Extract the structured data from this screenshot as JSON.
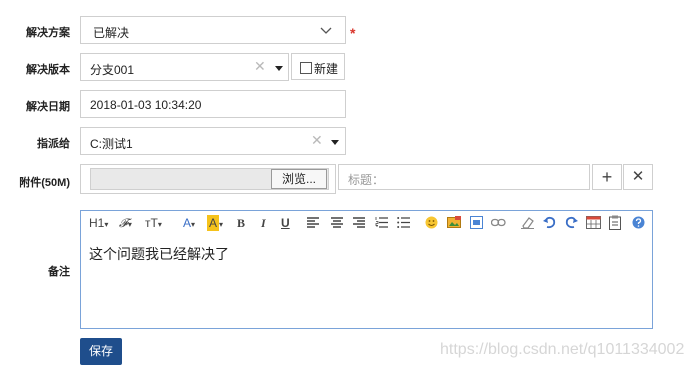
{
  "form": {
    "solution_label": "解决方案",
    "solution_value": "已解决",
    "required_mark": "*",
    "version_label": "解决版本",
    "version_value": "分支001",
    "new_label": "新建",
    "date_label": "解决日期",
    "date_value": "2018-01-03 10:34:20",
    "assign_label": "指派给",
    "assign_value": "C:测试1",
    "attach_label": "附件(50M)",
    "browse_label": "浏览...",
    "title_placeholder": "标题：",
    "add_symbol": "+",
    "remove_symbol": "✕",
    "clear_symbol": "✕",
    "remark_label": "备注",
    "remark_text": "这个问题我已经解决了",
    "save_label": "保存"
  },
  "toolbar": {
    "heading": "H1",
    "font_family": "𝓕",
    "font_size": "тT",
    "font_color": "A",
    "bg_color": "A",
    "bold": "B",
    "italic": "I",
    "underline": "U",
    "icons": [
      "align-left-icon",
      "align-center-icon",
      "align-right-icon",
      "ordered-list-icon",
      "unordered-list-icon",
      "emoji-icon",
      "image-icon",
      "media-icon",
      "link-icon",
      "eraser-icon",
      "undo-icon",
      "redo-icon",
      "table-icon",
      "paste-icon",
      "help-icon"
    ]
  },
  "colors": {
    "save_bg": "#1f4e8c",
    "required": "#d9352b",
    "editor_border": "#7aa3d9",
    "bg_highlight": "#f5c21b"
  },
  "watermark": "https://blog.csdn.net/q1011334002"
}
